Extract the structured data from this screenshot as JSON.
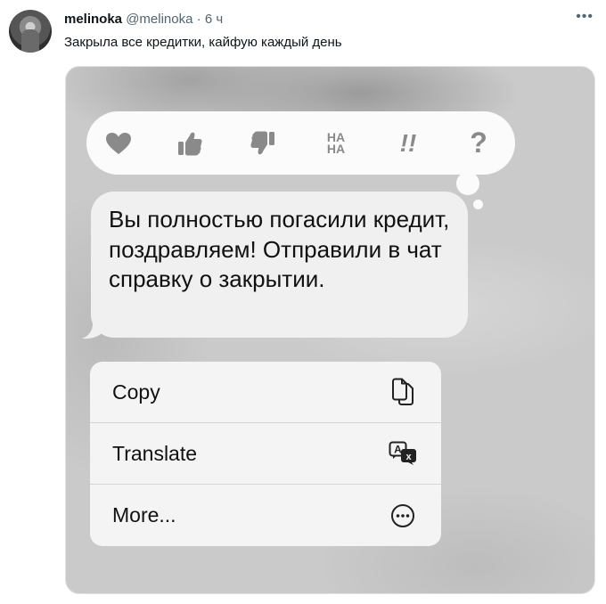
{
  "tweet": {
    "author_name": "melinoka",
    "author_handle": "@melinoka",
    "separator": "·",
    "time": "6 ч",
    "text": "Закрыла все кредитки, кайфую каждый день",
    "more_icon": "ellipsis-icon"
  },
  "screenshot": {
    "reactions": [
      {
        "name": "heart",
        "icon": "heart-icon"
      },
      {
        "name": "thumbs-up",
        "icon": "thumbs-up-icon"
      },
      {
        "name": "thumbs-down",
        "icon": "thumbs-down-icon"
      },
      {
        "name": "haha",
        "icon": "haha-icon",
        "line1": "HA",
        "line2": "HA"
      },
      {
        "name": "emphasize",
        "icon": "double-exclamation-icon",
        "text": "!!"
      },
      {
        "name": "question",
        "icon": "question-mark-icon",
        "text": "?"
      }
    ],
    "message": "Вы полностью погасили кредит, поздравляем! Отправили в чат справку о закрытии.",
    "menu": [
      {
        "label": "Copy",
        "icon": "copy-icon"
      },
      {
        "label": "Translate",
        "icon": "translate-icon"
      },
      {
        "label": "More...",
        "icon": "more-circle-icon"
      }
    ]
  },
  "colors": {
    "reaction_gray": "#8a8a8a",
    "text_primary": "#0f1419",
    "text_secondary": "#536471"
  }
}
